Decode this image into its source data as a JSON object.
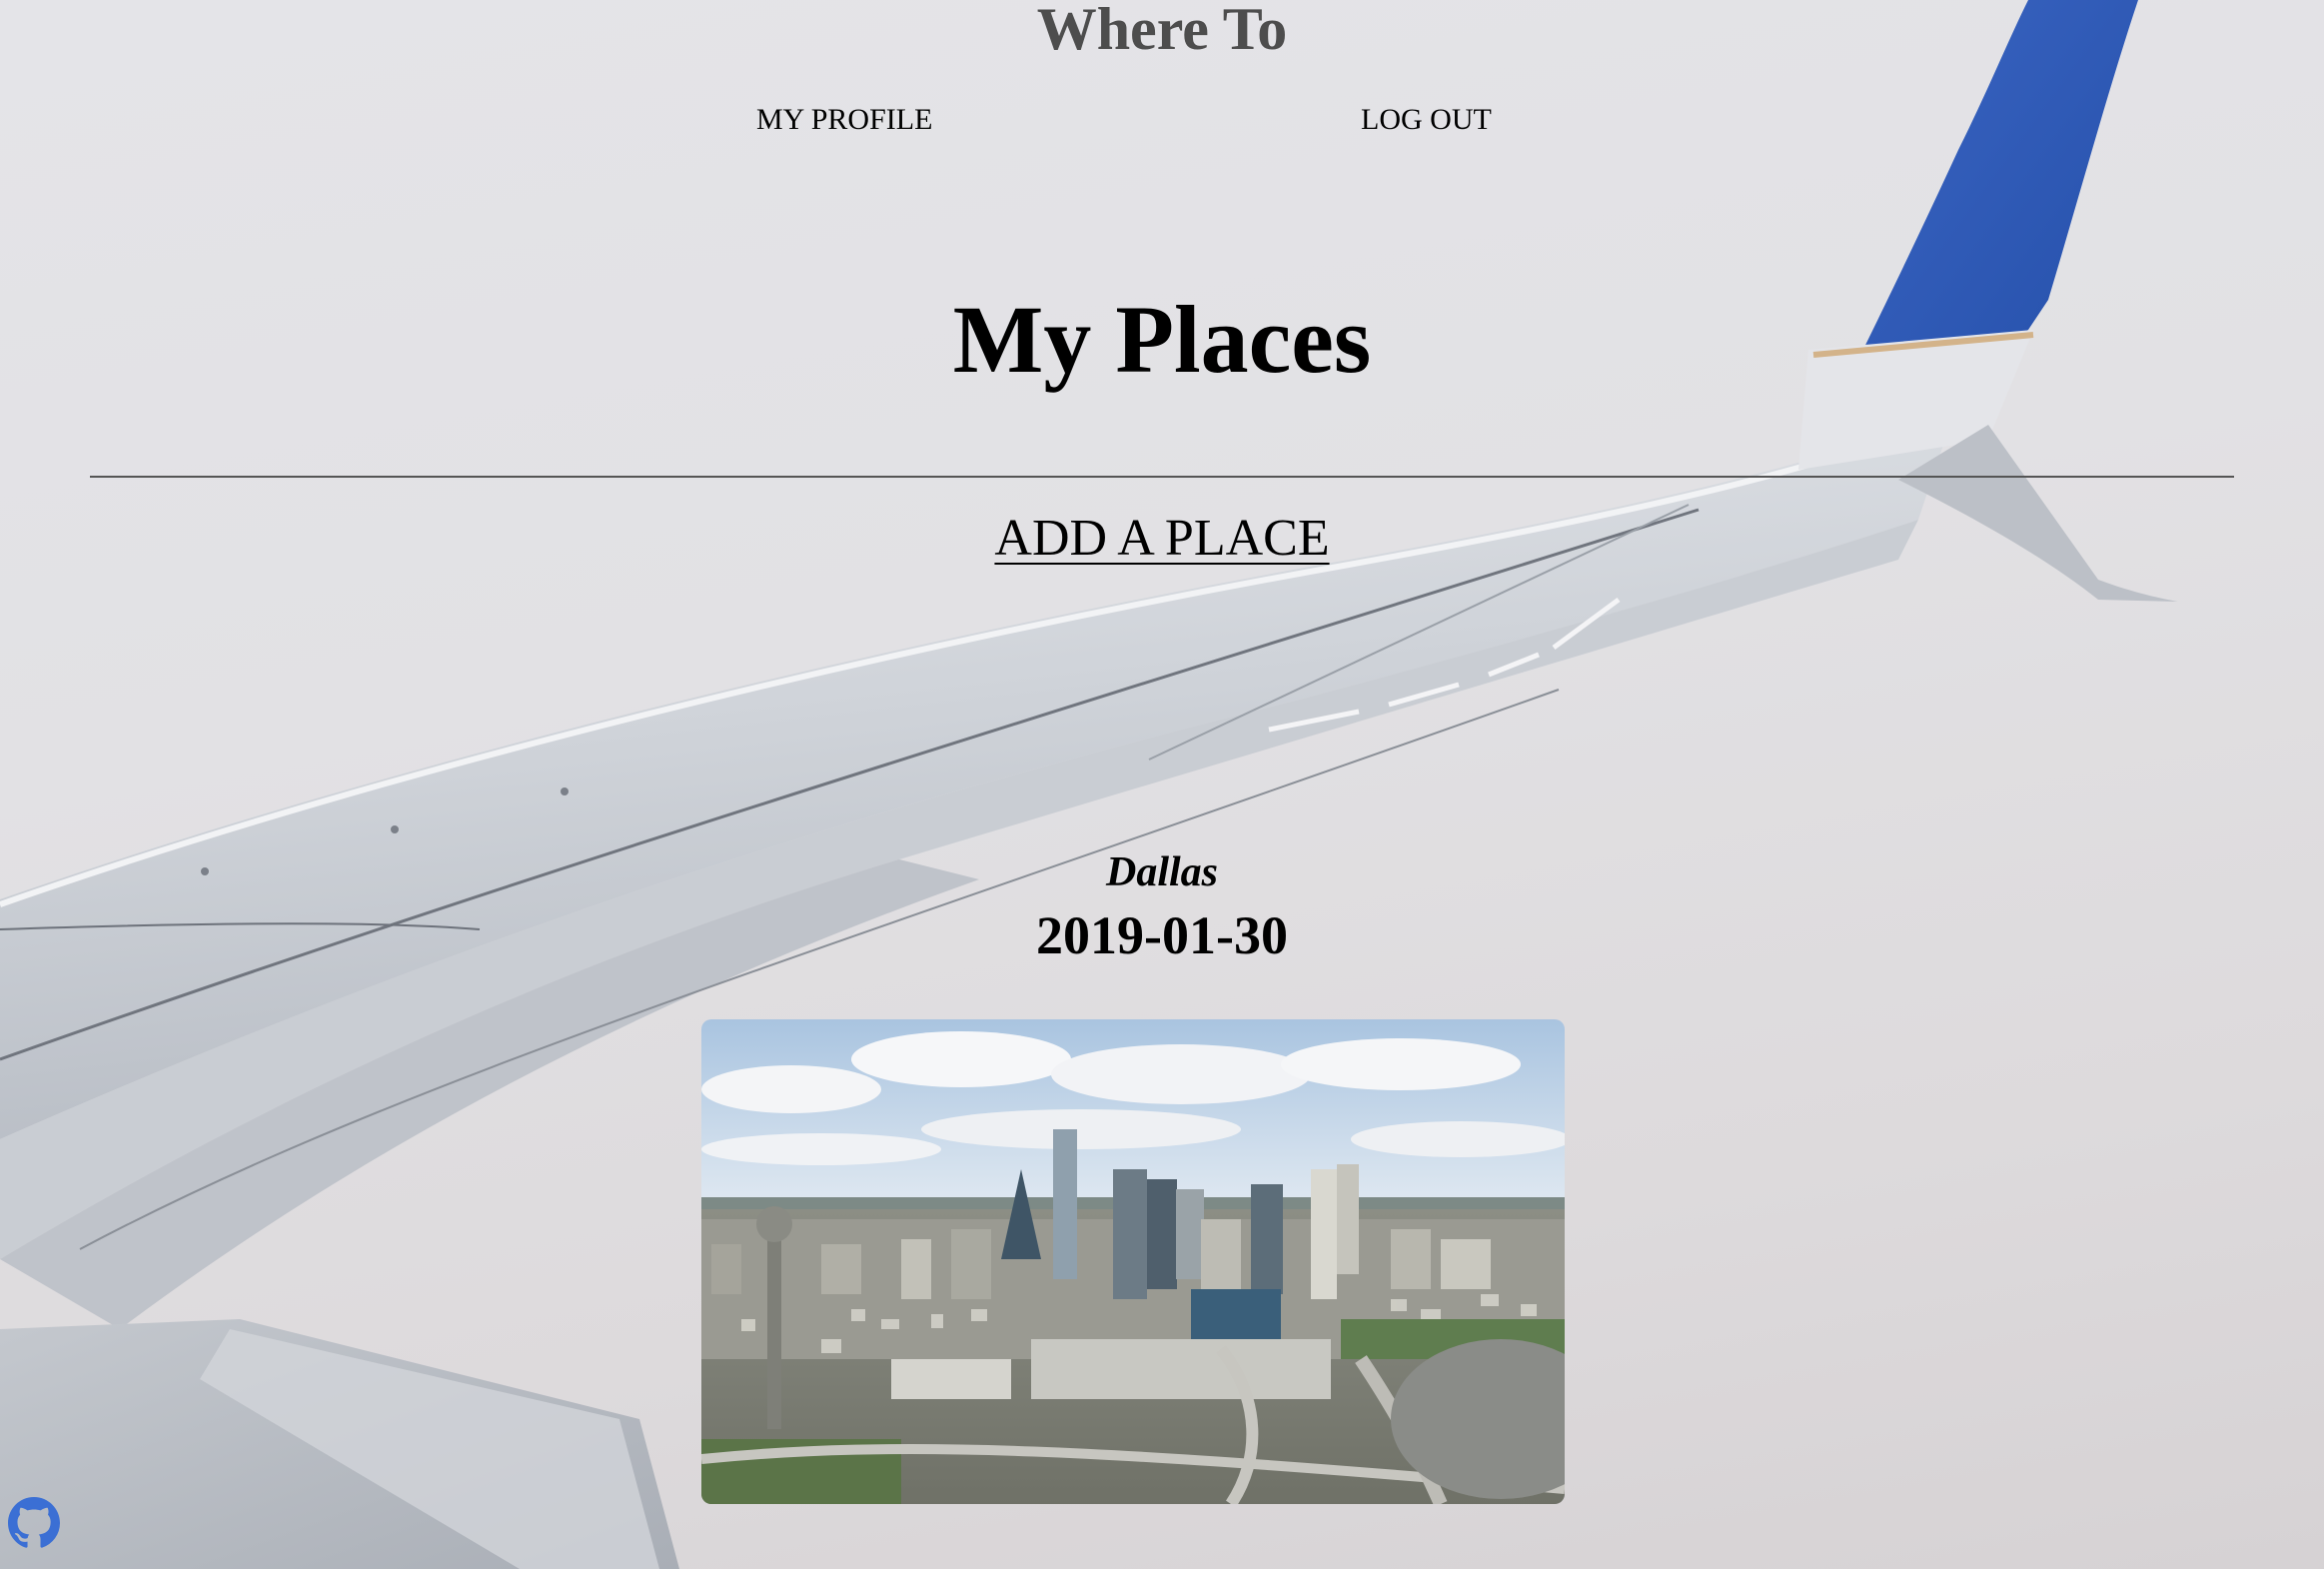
{
  "site": {
    "title": "Where To"
  },
  "nav": {
    "profile_label": "MY PROFILE",
    "logout_label": "LOG OUT"
  },
  "main": {
    "heading": "My Places",
    "add_place_label": "ADD A PLACE"
  },
  "places": [
    {
      "name": "Dallas",
      "date": "2019-01-30",
      "photo_alt": "Dallas"
    }
  ],
  "footer": {
    "github_icon": "github-icon",
    "github_color": "#3b6fd4"
  },
  "colors": {
    "title": "#4d4d4d",
    "text": "#000000",
    "wing_blue": "#2e57b5"
  }
}
